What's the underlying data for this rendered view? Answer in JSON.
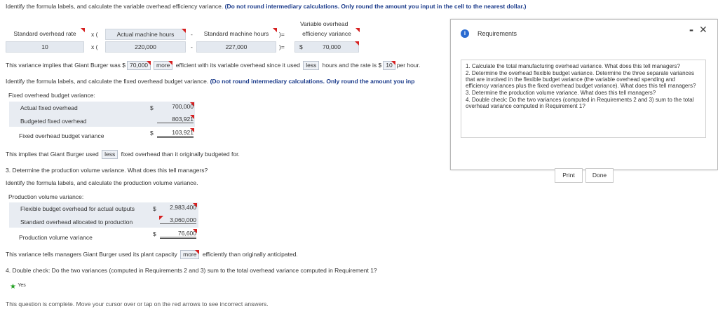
{
  "instruction1": {
    "prefix": "Identify the formula labels, and calculate the variable overhead efficiency variance.",
    "bold": "(Do not round intermediary calculations. Only round the amount you input in the cell to the nearest dollar.)"
  },
  "formula1": {
    "header_line1": "Variable overhead",
    "labels": [
      "Standard overhead rate",
      "x (",
      "Actual machine hours",
      "-",
      "Standard machine hours",
      ")=",
      "efficiency variance"
    ],
    "values": [
      "10",
      "x (",
      "220,000",
      "-",
      "227,000",
      ")=",
      "$",
      "70,000"
    ]
  },
  "implication1": {
    "p1": "This variance implies that Giant Burger was $",
    "amount": "70,000",
    "word1": "more",
    "p2": "efficient with its variable overhead since it used",
    "word2": "less",
    "p3": "hours and the rate is $",
    "rate": "10",
    "p4": "per hour."
  },
  "instruction2": {
    "prefix": "Identify the formula labels, and calculate the fixed overhead budget variance.",
    "bold": "(Do not round intermediary calculations. Only round the amount you inp"
  },
  "fixed_budget": {
    "title": "Fixed overhead budget variance:",
    "rows": [
      {
        "label": "Actual fixed overhead",
        "currency": "$",
        "value": "700,000"
      },
      {
        "label": "Budgeted fixed overhead",
        "currency": "",
        "value": "803,921"
      },
      {
        "label": "Fixed overhead budget variance",
        "currency": "$",
        "value": "103,921"
      }
    ]
  },
  "implication2": {
    "p1": "This implies that Giant Burger used",
    "word": "less",
    "p2": "fixed overhead than it originally budgeted for."
  },
  "req3": {
    "title": "3. Determine the production volume variance. What does this tell managers?",
    "instruction": "Identify the formula labels, and calculate the production volume variance."
  },
  "prod_volume": {
    "title": "Production volume variance:",
    "rows": [
      {
        "label": "Flexible budget overhead for actual outputs",
        "currency": "$",
        "value": "2,983,400"
      },
      {
        "label": "Standard overhead allocated to production",
        "currency": "",
        "value": "3,060,000"
      },
      {
        "label": "Production volume variance",
        "currency": "$",
        "value": "76,600"
      }
    ]
  },
  "implication3": {
    "p1": "This variance tells managers Giant Burger used its plant capacity",
    "word": "more",
    "p2": "efficiently than originally anticipated."
  },
  "req4": {
    "title": "4. Double check: Do the two variances (computed in Requirements 2 and 3) sum to the total overhead variance computed in Requirement 1?",
    "answer": "Yes"
  },
  "footer": "This question is complete. Move your cursor over or tap on the red arrows to see incorrect answers.",
  "popup": {
    "title": "Requirements",
    "info_icon": "i",
    "minimize": "-",
    "close": "✕",
    "items": [
      "1. Calculate the total manufacturing overhead variance. What does this tell managers?",
      "2. Determine the overhead flexible budget variance. Determine the three separate variances that are involved in the flexible budget variance (the variable overhead spending and efficiency variances plus the fixed overhead budget variance). What does this tell managers?",
      "3. Determine the production volume variance. What does this tell managers?",
      "4. Double check: Do the two variances (computed in Requirements 2 and 3) sum to the total overhead variance computed in Requirement 1?"
    ],
    "print_label": "Print",
    "done_label": "Done"
  }
}
